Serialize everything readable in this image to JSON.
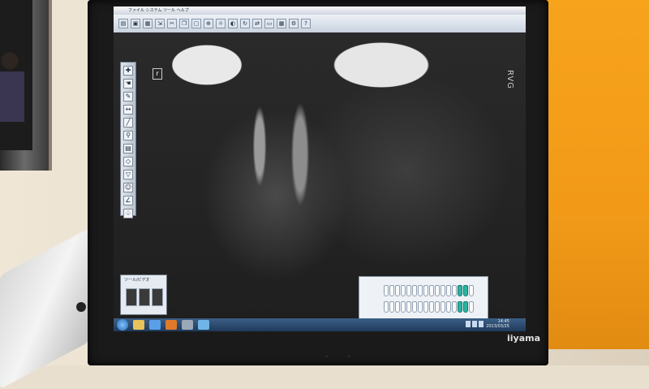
{
  "window": {
    "title": "ファイル  システム  ツール  ヘルプ",
    "toolbar_icons": [
      "folder-icon",
      "save-icon",
      "print-icon",
      "export-icon",
      "scissors-icon",
      "copy-icon",
      "paste-icon",
      "zoom-icon",
      "brightness-icon",
      "contrast-icon",
      "rotate-icon",
      "flip-icon",
      "ruler-icon",
      "grid-icon",
      "settings-icon",
      "help-icon"
    ]
  },
  "viewer": {
    "orientation_mark": "r",
    "vendor_mark": "RVG",
    "left_tools": [
      "select-icon",
      "hand-icon",
      "pen-icon",
      "measure-icon",
      "line-icon",
      "magnifier-icon",
      "layers-icon",
      "cube-icon",
      "filter-icon",
      "person-icon",
      "angle-icon",
      "tooth-icon"
    ]
  },
  "thumbnail_panel": {
    "title": "ツール/ビデオ"
  },
  "tooth_chart": {
    "upper": [
      0,
      0,
      0,
      0,
      0,
      0,
      0,
      0,
      0,
      0,
      0,
      0,
      0,
      1,
      1,
      0
    ],
    "lower": [
      0,
      0,
      0,
      0,
      0,
      0,
      0,
      0,
      0,
      0,
      0,
      0,
      0,
      1,
      1,
      0
    ],
    "selection_color": "#2bb3a0"
  },
  "taskbar": {
    "time": "14:45",
    "date": "2013/03/25",
    "start_icon": "windows-start-icon",
    "pinned": [
      "explorer-icon",
      "ie-icon",
      "media-icon",
      "app-icon",
      "chart-icon"
    ]
  },
  "monitor": {
    "brand": "iiyama"
  },
  "colors": {
    "wall": "#e9dfcf",
    "orange_panel": "#f29a18",
    "bezel": "#1a1a1a",
    "taskbar": "#2b4a70"
  }
}
